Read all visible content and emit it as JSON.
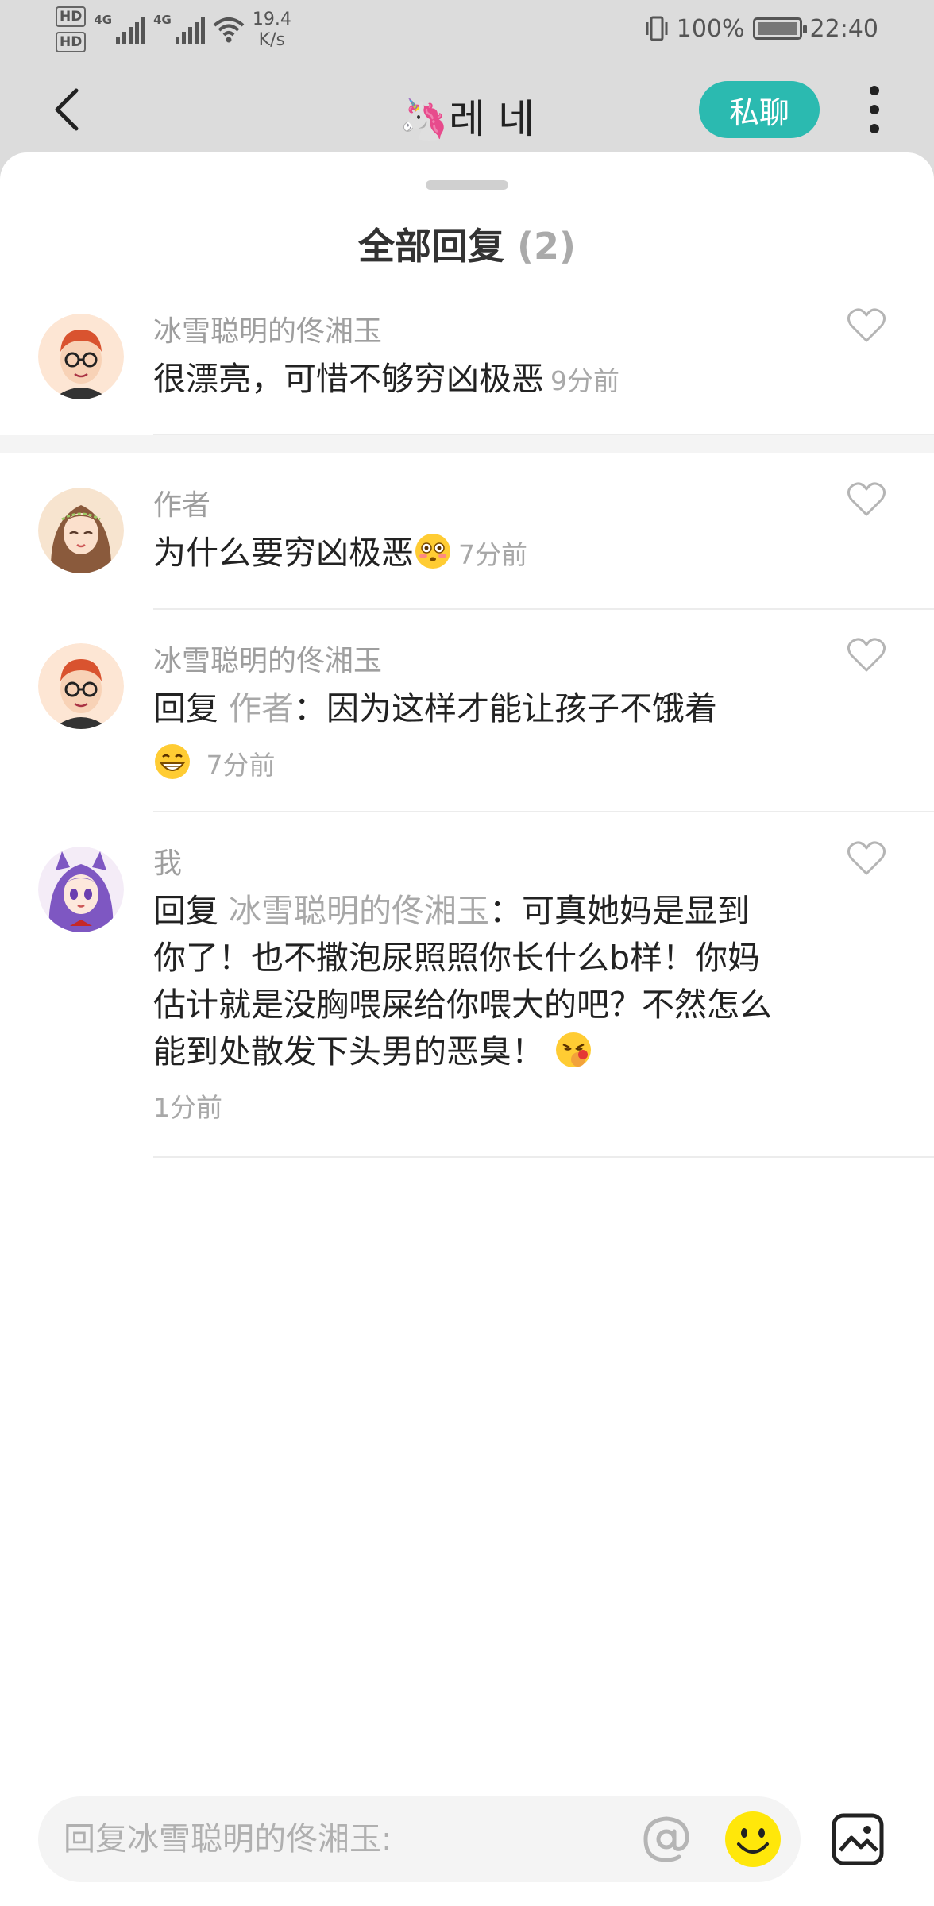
{
  "status_bar": {
    "hd1": "HD",
    "hd2": "HD",
    "net1": "4G",
    "net2": "4G",
    "speed_value": "19.4",
    "speed_unit": "K/s",
    "battery": "100%",
    "time": "22:40"
  },
  "nav": {
    "title_emoji": "🦄",
    "title": "레 네",
    "dm_label": "私聊"
  },
  "sheet": {
    "title": "全部回复",
    "count": "(2)"
  },
  "comments": [
    {
      "name": "冰雪聪明的佟湘玉",
      "text": "很漂亮，可惜不够穷凶极恶",
      "time": "9分前",
      "avatar": "avatar-boy-glasses"
    },
    {
      "name": "作者",
      "text": "为什么要穷凶极恶",
      "time": "7分前",
      "avatar": "avatar-girl-brown-hair",
      "emoji": "flushed-face"
    },
    {
      "name": "冰雪聪明的佟湘玉",
      "reply_prefix": "回复",
      "reply_to": "作者",
      "text": "：因为这样才能让孩子不饿着",
      "time": "7分前",
      "avatar": "avatar-boy-glasses",
      "emoji": "grinning-face"
    },
    {
      "name": "我",
      "reply_prefix": "回复",
      "reply_to": "冰雪聪明的佟湘玉",
      "text": "：可真她妈是显到你了！也不撒泡尿照照你长什么b样！你妈估计就是没胸喂屎给你喂大的吧？不然怎么能到处散发下头男的恶臭！",
      "time": "1分前",
      "avatar": "avatar-girl-purple-hair",
      "emoji": "face-holding-back-vomit"
    }
  ],
  "reply_bar": {
    "placeholder": "回复冰雪聪明的佟湘玉:"
  },
  "colors": {
    "accent": "#2bbab0",
    "muted_text": "#a8a8a8",
    "header_bg": "#dcdcdc"
  }
}
